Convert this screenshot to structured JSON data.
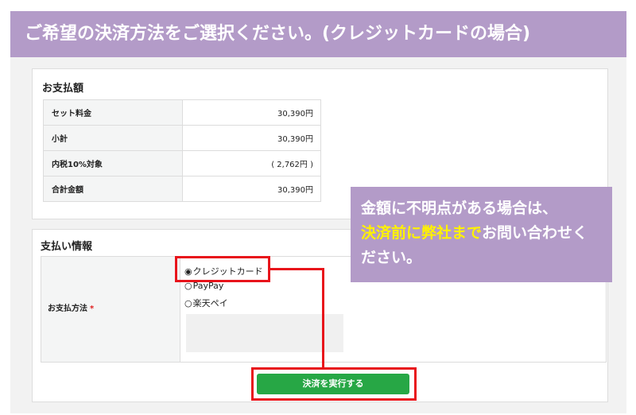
{
  "banner": {
    "title": "ご希望の決済方法をご選択ください。(クレジットカードの場合)"
  },
  "payment_amount": {
    "title": "お支払額",
    "rows": [
      {
        "label": "セット料金",
        "value": "30,390円"
      },
      {
        "label": "小計",
        "value": "30,390円"
      },
      {
        "label": "内税10%対象",
        "value": "( 2,762円 )"
      },
      {
        "label": "合計金額",
        "value": "30,390円"
      }
    ]
  },
  "payment_info": {
    "title": "支払い情報",
    "method_label": "お支払方法",
    "required_mark": "*",
    "options": [
      {
        "mark": "◉",
        "label": "クレジットカード",
        "selected": true
      },
      {
        "mark": "○",
        "label": "PayPay",
        "selected": false
      },
      {
        "mark": "○",
        "label": "楽天ペイ",
        "selected": false
      }
    ]
  },
  "submit": {
    "label": "決済を実行する"
  },
  "callout": {
    "line1": "金額に不明点がある場合は、",
    "emphasis": "決済前に弊社まで",
    "rest": "お問い合わせください。"
  },
  "colors": {
    "banner_bg": "#b39bc8",
    "submit_bg": "#27a745",
    "highlight": "#e8141b",
    "callout_emphasis": "#fff200"
  }
}
